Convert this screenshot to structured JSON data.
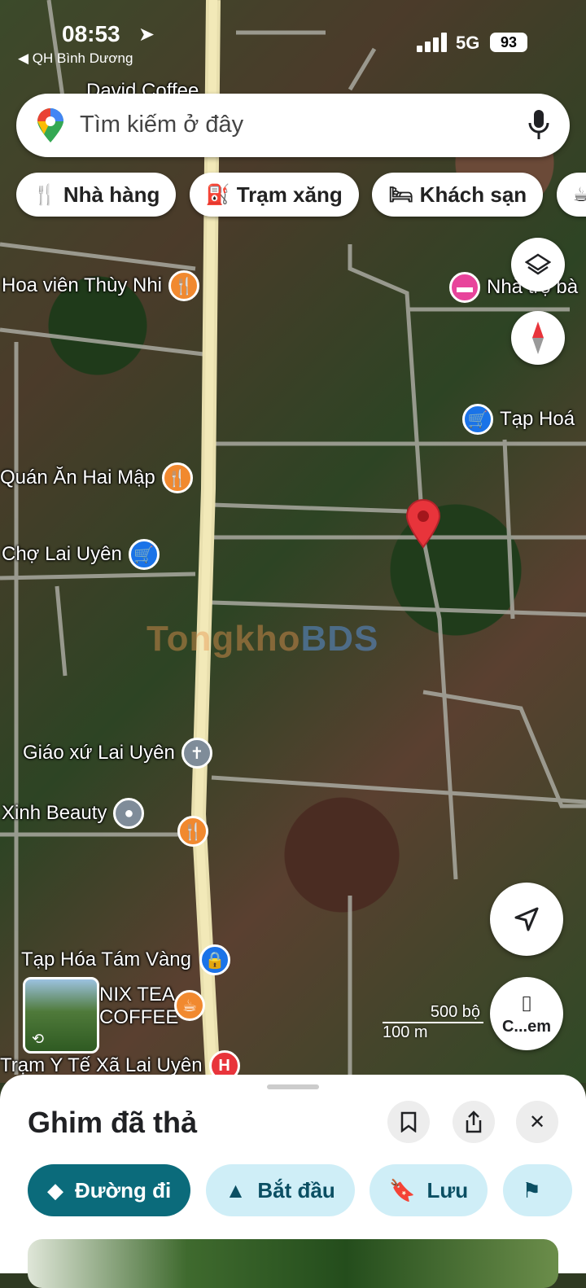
{
  "status_bar": {
    "time": "08:53",
    "back_app": "◀ QH Bình Dương",
    "network": "5G",
    "battery": "93"
  },
  "search": {
    "placeholder": "Tìm kiếm ở đây"
  },
  "chips": [
    {
      "label": "Nhà hàng",
      "icon": "fork-knife-icon"
    },
    {
      "label": "Trạm xăng",
      "icon": "gas-pump-icon"
    },
    {
      "label": "Khách sạn",
      "icon": "bed-icon"
    }
  ],
  "pois": {
    "david_coffee": "David Coffee",
    "hoa_vien": "Hoa viên Thùy Nhi",
    "nha_tro": "Nhà trọ bà",
    "tap_hoa_right": "Tạp Hoá",
    "quan_an": "Quán Ăn Hai Mập",
    "cho": "Chợ Lai Uyên",
    "giao_xu": "Giáo xứ Lai Uyên",
    "xinh_beauty": "Xinh Beauty",
    "tap_hoa_tam_vang": "Tạp Hóa Tám Vàng",
    "nix_tea": "NIX TEA",
    "coffee": "COFFEE",
    "tram_y_te": "Trạm Y Tế Xã Lai Uyên"
  },
  "colors": {
    "restaurant": "#f1892f",
    "shop": "#1a73e8",
    "lodging": "#e8449b",
    "church": "#7f8c99",
    "hospital": "#e8343b",
    "pin": "#e8343b"
  },
  "watermark": {
    "part1": "Tongkho",
    "part2": "BDS"
  },
  "scale": {
    "upper": "500 bộ",
    "lower": "100 m"
  },
  "lens_label": "C...em",
  "sheet": {
    "title": "Ghim đã thả",
    "actions": [
      {
        "label": "Đường đi",
        "icon": "directions-icon"
      },
      {
        "label": "Bắt đầu",
        "icon": "navigation-arrow-icon"
      },
      {
        "label": "Lưu",
        "icon": "bookmark-icon"
      }
    ]
  }
}
